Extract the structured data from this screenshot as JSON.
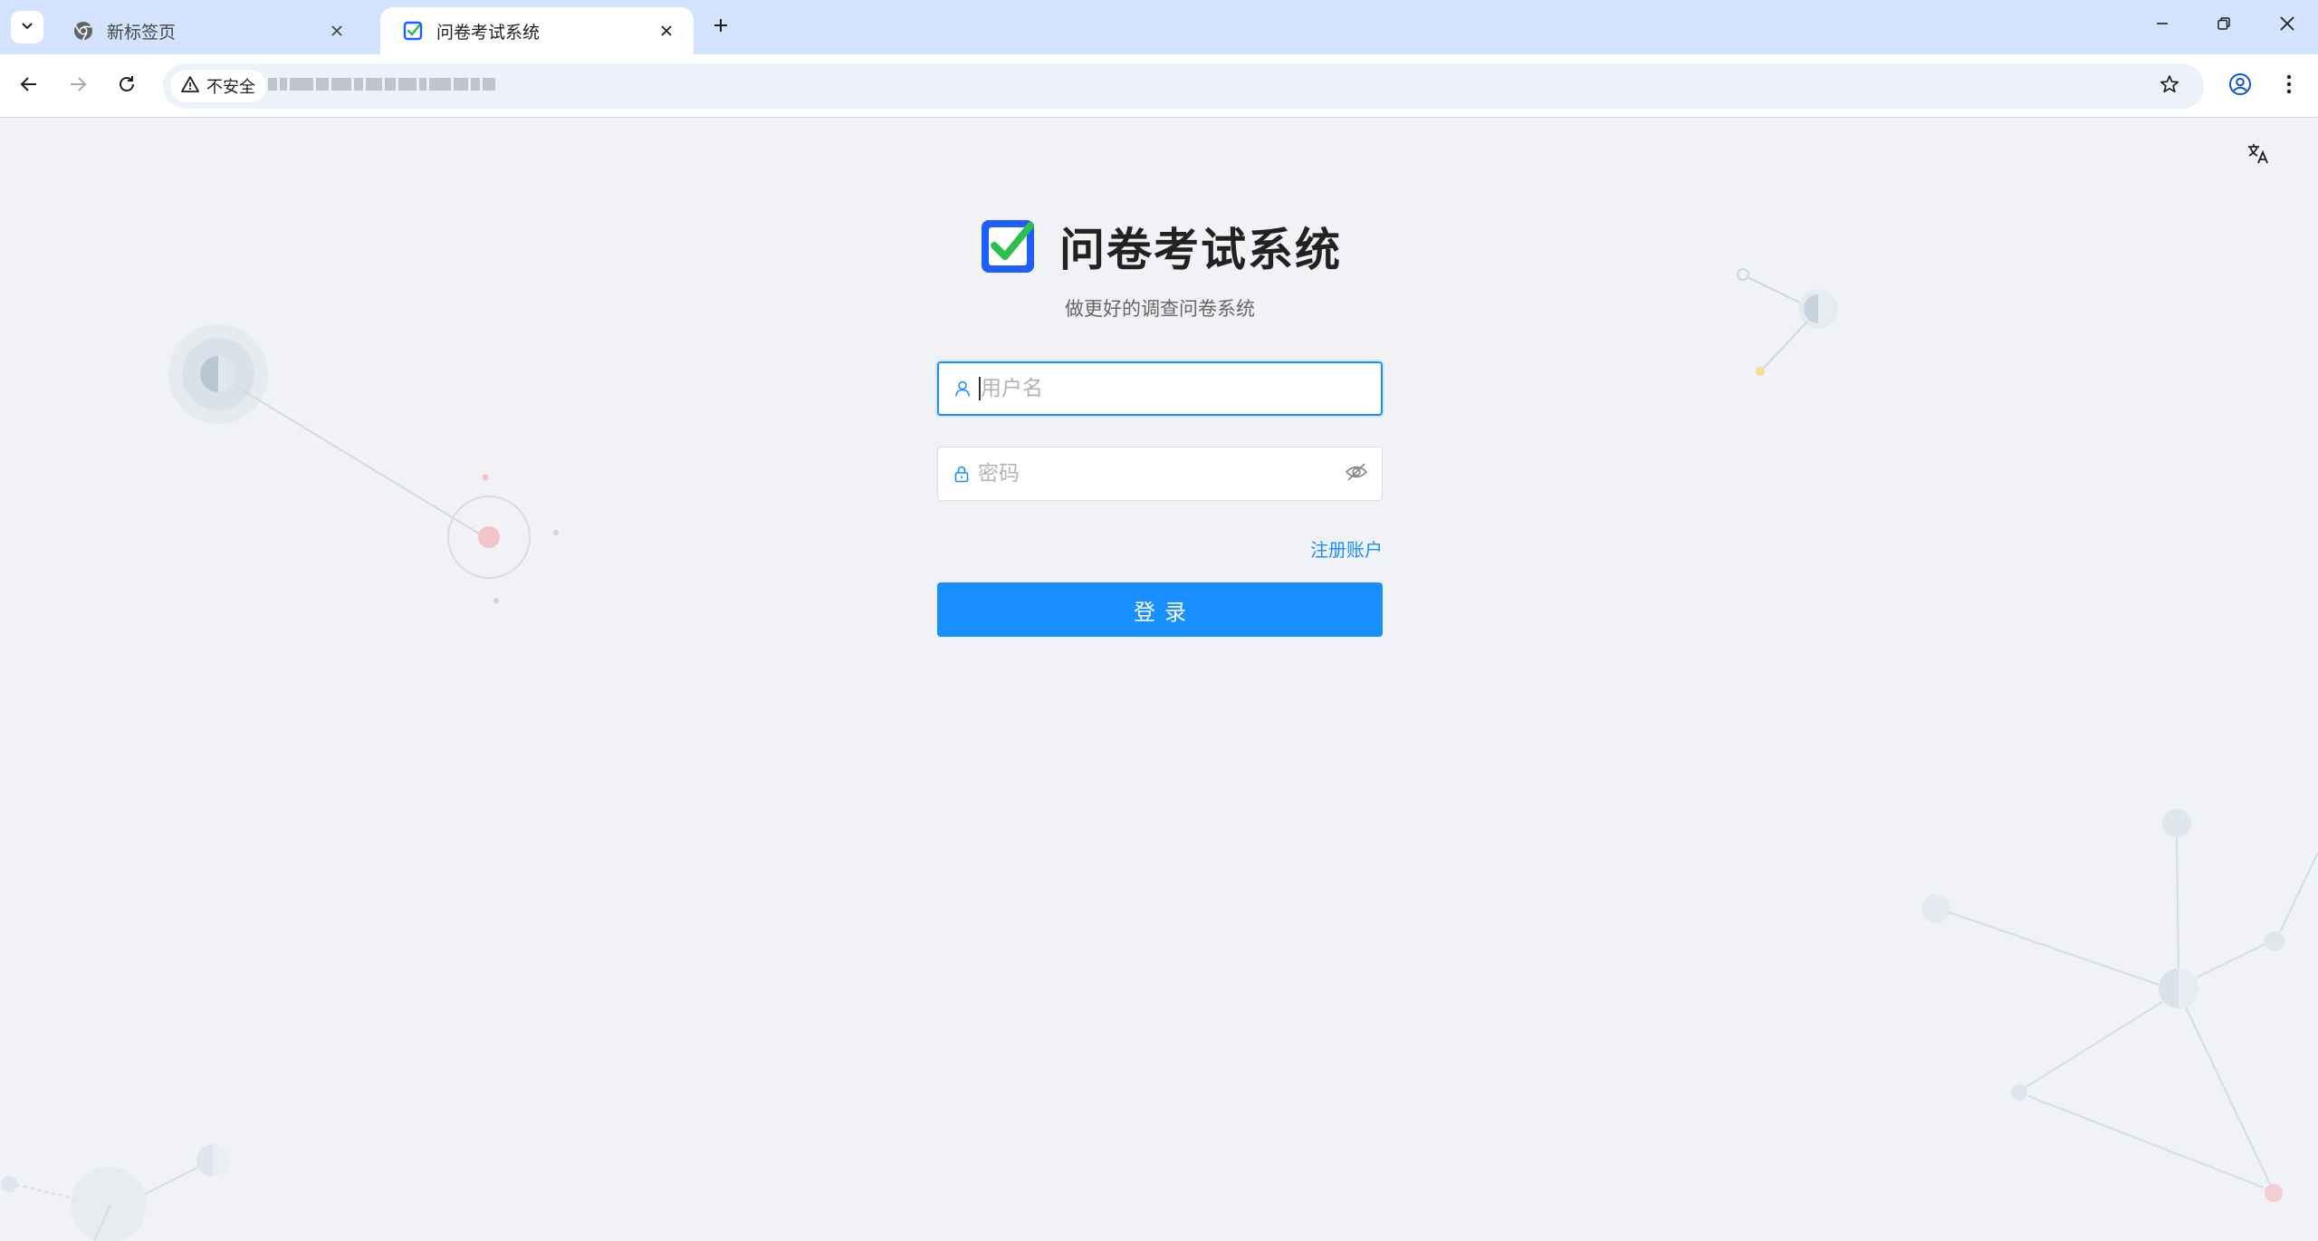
{
  "browser": {
    "tabs": [
      {
        "title": "新标签页",
        "active": false,
        "icon": "chrome-icon"
      },
      {
        "title": "问卷考试系统",
        "active": true,
        "icon": "questionnaire-favicon"
      }
    ],
    "security_label": "不安全",
    "icons": {
      "tab_search": "chevron-down-icon",
      "new_tab": "plus-icon",
      "minimize": "minimize-icon",
      "restore": "restore-icon",
      "close": "close-icon",
      "back": "back-arrow-icon",
      "forward": "forward-arrow-icon",
      "reload": "reload-icon",
      "warning": "warning-icon",
      "bookmark": "star-icon",
      "profile": "profile-icon",
      "menu": "kebab-menu-icon"
    }
  },
  "page": {
    "translate_icon": "translate-icon",
    "brand": {
      "title": "问卷考试系统",
      "subtitle": "做更好的调查问卷系统"
    },
    "login_form": {
      "username": {
        "value": "",
        "placeholder": "用户名",
        "icon": "user-icon"
      },
      "password": {
        "value": "",
        "placeholder": "密码",
        "icon": "lock-icon",
        "toggle_icon": "eye-off-icon"
      },
      "register_link": "注册账户",
      "submit_label": "登录"
    }
  },
  "colors": {
    "tabbar_bg": "#d3e3fd",
    "page_bg": "#f0f2f5",
    "primary": "#1890ff",
    "logo_blue": "#1e5eff",
    "logo_green": "#2fbf4f"
  }
}
